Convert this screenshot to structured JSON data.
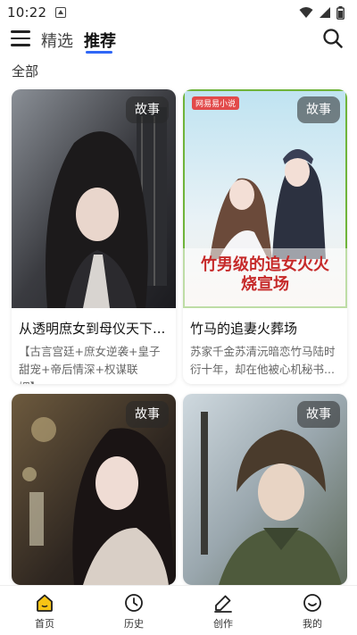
{
  "status_bar": {
    "time": "10:22"
  },
  "header": {
    "tabs": [
      {
        "label": "精选"
      },
      {
        "label": "推荐"
      }
    ]
  },
  "section": {
    "title": "全部"
  },
  "cards": [
    {
      "badge": "故事",
      "title": "从透明庶女到母仪天下...",
      "desc": "【古言宫廷+庶女逆袭+皇子甜宠+帝后情深+权谋联姻】..."
    },
    {
      "badge": "故事",
      "title": "竹马的追妻火葬场",
      "desc": "苏家千金苏清沅暗恋竹马陆时衍十年，却在他被心机秘书...",
      "cover_small": "网易易小说",
      "cover_title": "竹男级的追女火火烧宣场"
    },
    {
      "badge": "故事"
    },
    {
      "badge": "故事"
    }
  ],
  "bottom_nav": [
    {
      "label": "首页",
      "icon": "home-icon",
      "active": true
    },
    {
      "label": "历史",
      "icon": "clock-icon"
    },
    {
      "label": "创作",
      "icon": "pen-icon"
    },
    {
      "label": "我的",
      "icon": "smiley-icon"
    }
  ],
  "colors": {
    "accent": "#2f67f6",
    "home_active": "#f7c415"
  }
}
